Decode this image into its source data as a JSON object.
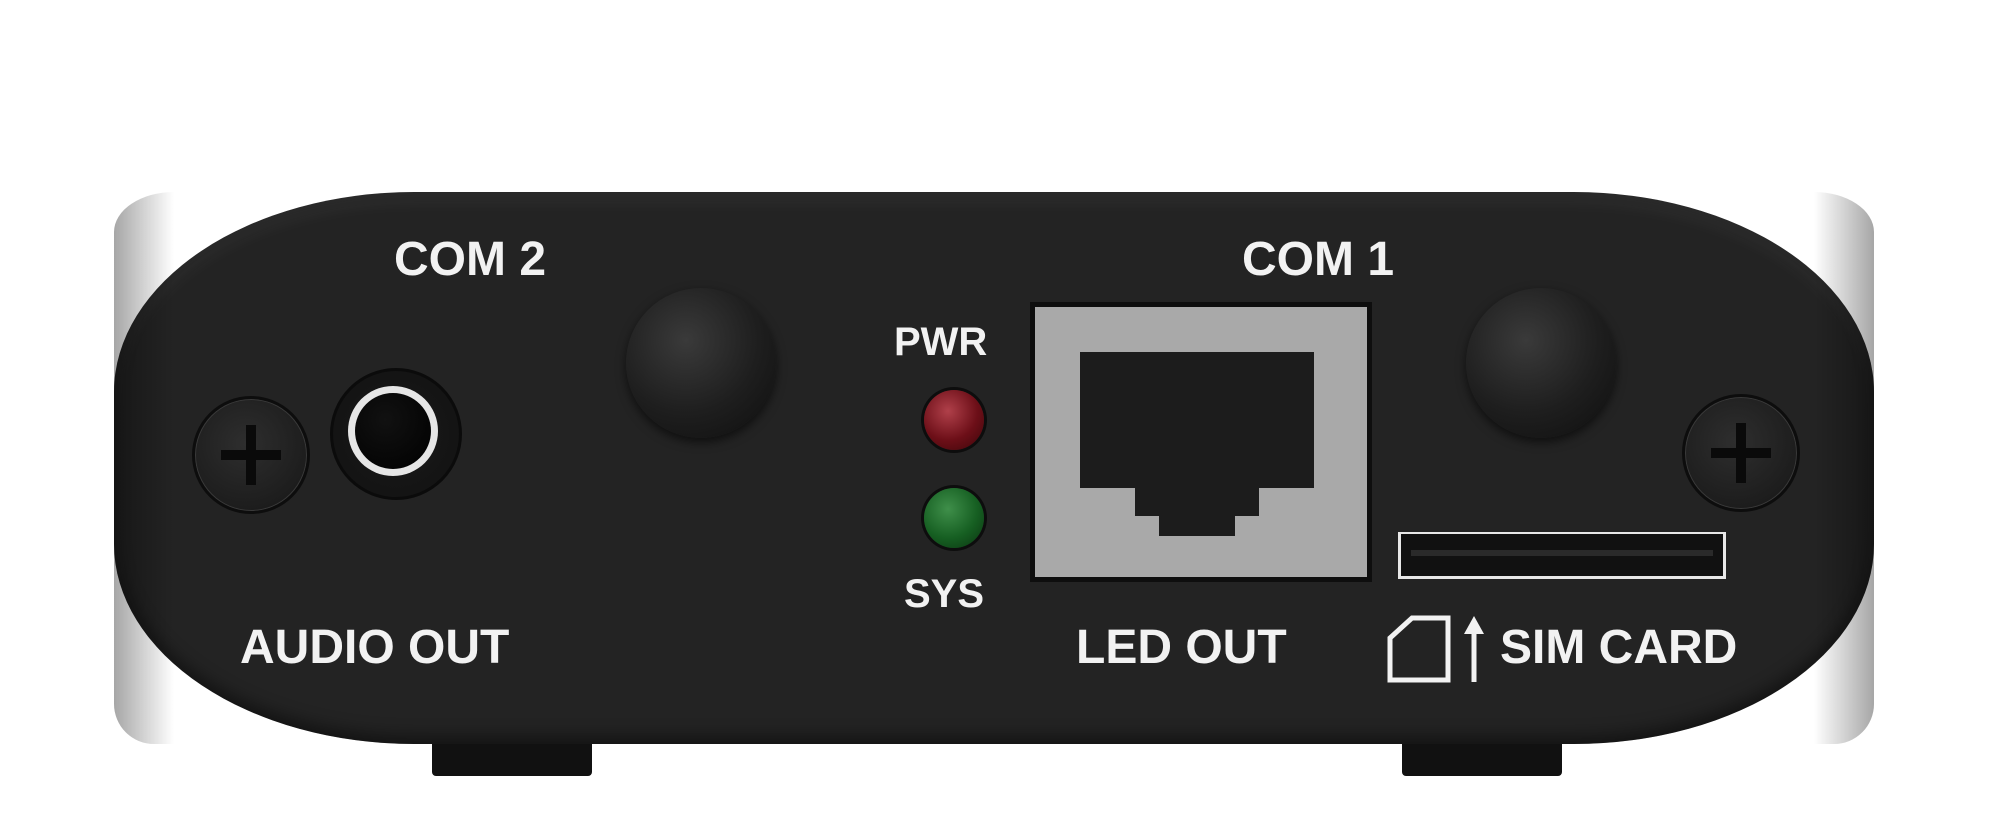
{
  "device": {
    "labels": {
      "com2": "COM 2",
      "com1": "COM 1",
      "pwr": "PWR",
      "sys": "SYS",
      "audio_out": "AUDIO OUT",
      "led_out": "LED OUT",
      "sim_card": "SIM CARD"
    },
    "leds": {
      "pwr_color": "#8b1a24",
      "sys_color": "#1f6b2b"
    },
    "icons": [
      "screw-icon",
      "audio-jack-icon",
      "knob-icon",
      "rj45-port-icon",
      "sim-slot-icon",
      "sim-card-arrow-icon"
    ],
    "colors": {
      "body": "#232323",
      "label": "#f2f2f2",
      "port": "#a9a9a9"
    }
  }
}
